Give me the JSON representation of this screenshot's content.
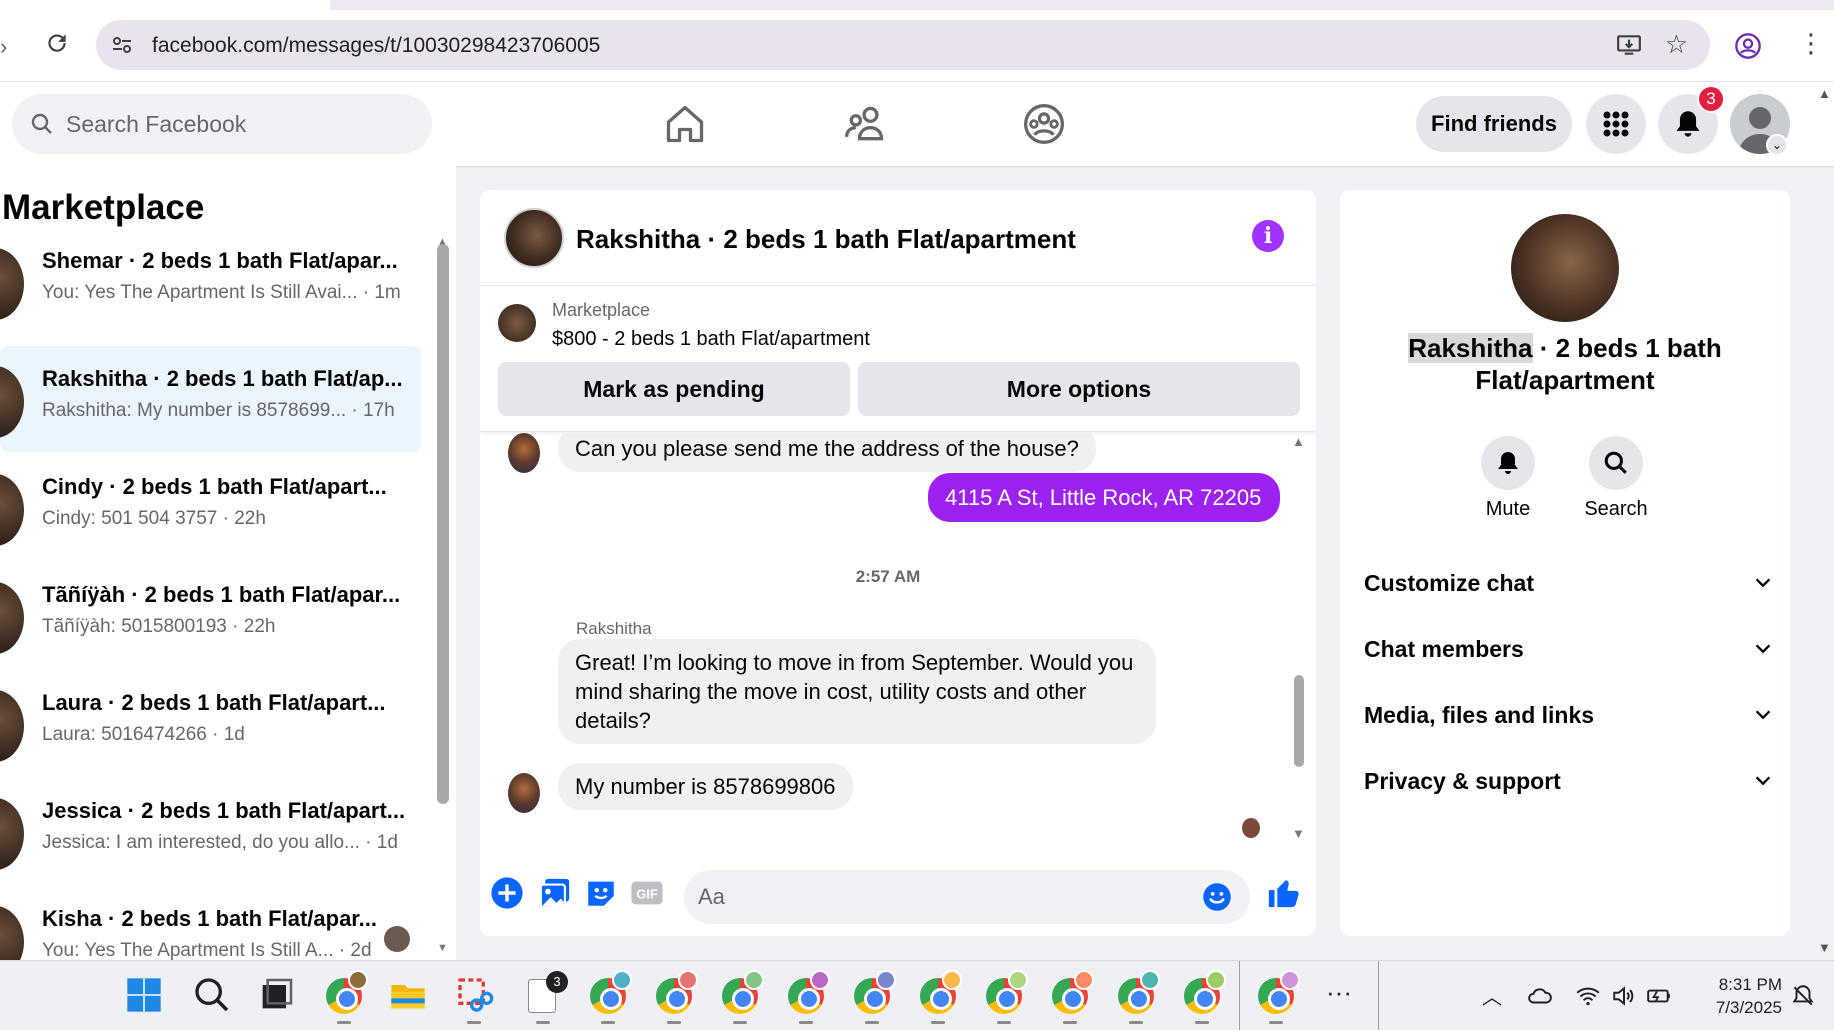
{
  "browser": {
    "url": "facebook.com/messages/t/10030298423706005"
  },
  "header": {
    "search_placeholder": "Search Facebook",
    "find_friends": "Find friends",
    "notification_count": "3"
  },
  "sidebar": {
    "title": "Marketplace",
    "conversations": [
      {
        "title": "Shemar · 2 beds 1 bath Flat/apar...",
        "preview": "You: Yes The Apartment Is Still Avai... · 1m",
        "active": false
      },
      {
        "title": "Rakshitha · 2 beds 1 bath Flat/ap...",
        "preview": "Rakshitha: My number is 8578699... · 17h",
        "active": true
      },
      {
        "title": "Cindy · 2 beds 1 bath Flat/apart...",
        "preview": "Cindy: 501 504 3757 · 22h",
        "active": false
      },
      {
        "title": "Tãñíÿàh · 2 beds 1 bath Flat/apar...",
        "preview": "Tãñíÿàh: 5015800193 · 22h",
        "active": false
      },
      {
        "title": "Laura · 2 beds 1 bath Flat/apart...",
        "preview": "Laura: 5016474266 · 1d",
        "active": false
      },
      {
        "title": "Jessica · 2 beds 1 bath Flat/apart...",
        "preview": "Jessica: I am interested, do you allo... · 1d",
        "active": false
      },
      {
        "title": "Kisha · 2 beds 1 bath Flat/apar...",
        "preview": "You: Yes The Apartment Is Still A... · 2d",
        "active": false
      }
    ]
  },
  "chat": {
    "title": "Rakshitha · 2 beds 1 bath Flat/apartment",
    "listing": {
      "label": "Marketplace",
      "price_title": "$800 - 2 beds 1 bath Flat/apartment",
      "mark_pending": "Mark as pending",
      "more_options": "More options"
    },
    "messages": {
      "m1": "Can you please send me the address of the house?",
      "m2": "4115 A St, Little Rock, AR 72205",
      "timestamp": "2:57 AM",
      "sender": "Rakshitha",
      "m3": "Great! I’m looking to move in from September. Would you mind sharing the move in cost, utility costs and other details?",
      "m4": "My number is 8578699806"
    },
    "composer_placeholder": "Aa"
  },
  "details": {
    "name_first": "Rakshitha",
    "name_rest": " · 2 beds 1 bath Flat/apartment",
    "mute": "Mute",
    "search": "Search",
    "sections": [
      "Customize chat",
      "Chat members",
      "Media, files and links",
      "Privacy & support"
    ]
  },
  "taskbar": {
    "time": "8:31 PM",
    "date": "7/3/2025",
    "notes_badge": "3"
  },
  "colors": {
    "messenger_purple": "#9b22f0",
    "fb_blue": "#0866ff",
    "notification_red": "#e41e3f"
  }
}
